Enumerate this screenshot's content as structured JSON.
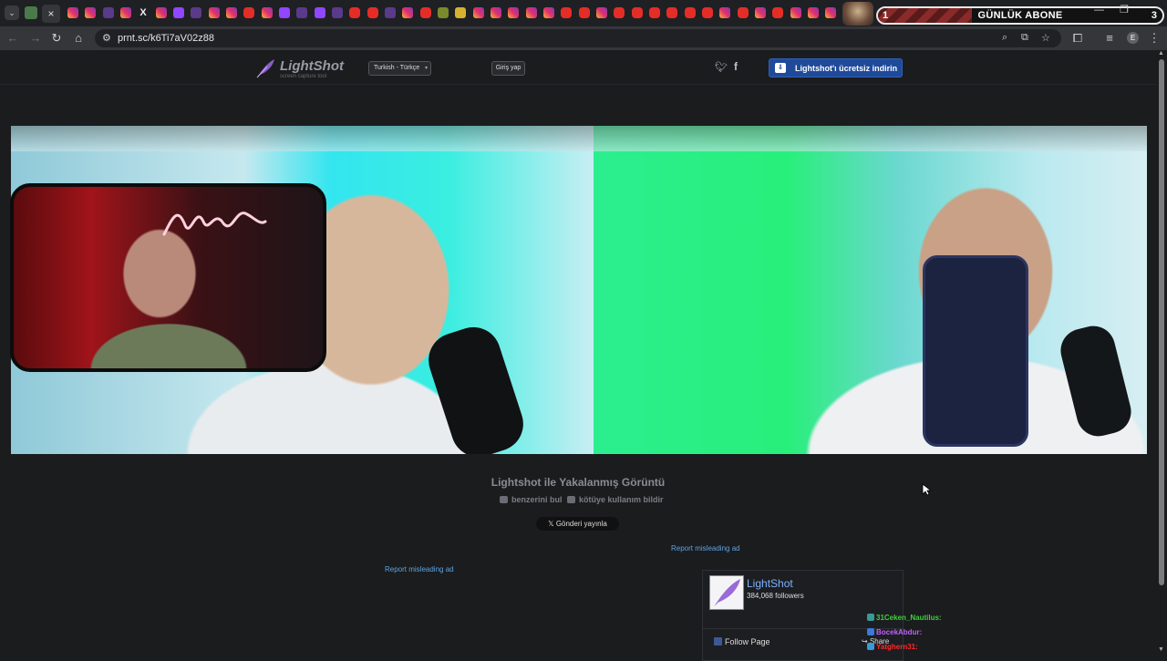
{
  "browser": {
    "tab_dropdown_icon": "chevron-down-icon",
    "active_tab_close": "×",
    "subscriber_goal": {
      "label": "GÜNLÜK ABONE",
      "current": "1",
      "target": "3",
      "progress": 0.33
    },
    "window_controls": {
      "minimize": "—",
      "restore": "❐",
      "close": "✕"
    },
    "url": "prnt.sc/k6Ti7aV02z88",
    "profile_initial": "E"
  },
  "site": {
    "logo_name": "LightShot",
    "logo_tagline": "screen capture tool",
    "language": "Turkish - Türkçe",
    "login": "Giriş yap",
    "download": "Lightshot'ı ücretsiz indirin",
    "image_title": "Lightshot ile Yakalanmış Görüntü",
    "find_similar": "benzerini bul",
    "report_abuse": "kötüye kullanım bildir",
    "post_button": "Gönderi yayınla",
    "report_ad_1": "Report misleading ad",
    "report_ad_2": "Report misleading ad",
    "facebook": {
      "page_name": "LightShot",
      "followers": "384,068 followers",
      "follow": "Follow Page",
      "share": "Share"
    }
  },
  "chat": [
    {
      "user": "31Ceken_Nautilus:",
      "color": "#3fcf3f"
    },
    {
      "user": "BocekAbdur:",
      "color": "#c060ff"
    },
    {
      "user": "Yatghern31:",
      "color": "#ff2a2a"
    }
  ],
  "colors": {
    "accent_link": "#5ea3e0",
    "download_bg": "#1f4a9a",
    "fb_name": "#7fb2ff"
  }
}
